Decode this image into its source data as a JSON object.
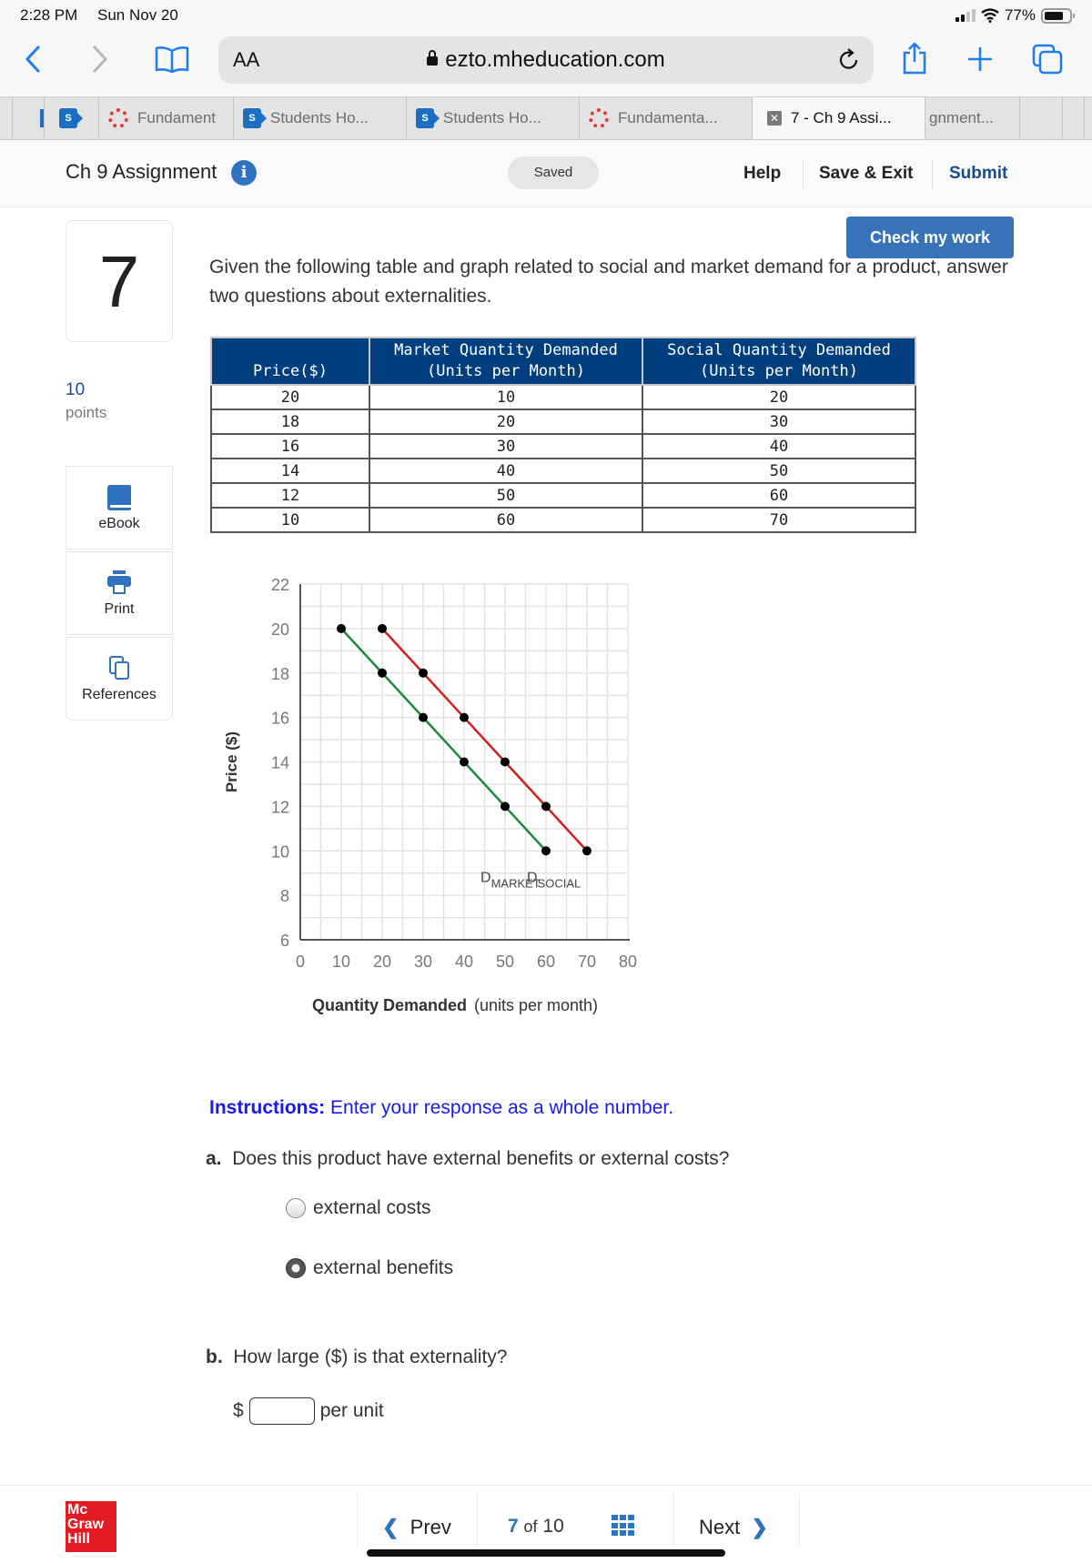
{
  "status_bar": {
    "time": "2:28 PM",
    "date": "Sun Nov 20",
    "battery": "77%",
    "battery_level_percent": 77
  },
  "browser": {
    "text_size_label": "AA",
    "url": "ezto.mheducation.com",
    "icons": [
      "back-icon",
      "forward-icon",
      "bookmarks-icon",
      "lock-icon",
      "reload-icon",
      "share-icon",
      "new-tab-icon",
      "tabs-overview-icon"
    ],
    "tabs": [
      {
        "label": "",
        "icon": "sharepoint-icon"
      },
      {
        "label": "Fundament",
        "icon": "canvas-icon"
      },
      {
        "label": "Students Ho...",
        "icon": "sharepoint-icon"
      },
      {
        "label": "Students Ho...",
        "icon": "sharepoint-icon"
      },
      {
        "label": "Fundamenta...",
        "icon": "canvas-icon"
      },
      {
        "label": "7 - Ch 9 Assi...",
        "icon": "close-tab-icon",
        "active": true
      },
      {
        "label": "gnment...",
        "icon": ""
      }
    ]
  },
  "header": {
    "title": "Ch 9 Assignment",
    "saved_status": "Saved",
    "help": "Help",
    "save_exit": "Save & Exit",
    "submit": "Submit"
  },
  "sidebar": {
    "question_number": "7",
    "points_value": "10",
    "points_label": "points",
    "tools": [
      {
        "label": "eBook",
        "icon": "book-icon"
      },
      {
        "label": "Print",
        "icon": "printer-icon"
      },
      {
        "label": "References",
        "icon": "references-icon"
      }
    ]
  },
  "question": {
    "check_button": "Check my work",
    "prompt": "Given the following table and graph related to social and market demand for a product, answer two questions about externalities.",
    "table": {
      "headers": [
        [
          "",
          "Price($)"
        ],
        [
          "Market Quantity Demanded",
          "(Units per Month)"
        ],
        [
          "Social Quantity Demanded",
          "(Units per Month)"
        ]
      ],
      "rows": [
        [
          "20",
          "10",
          "20"
        ],
        [
          "18",
          "20",
          "30"
        ],
        [
          "16",
          "30",
          "40"
        ],
        [
          "14",
          "40",
          "50"
        ],
        [
          "12",
          "50",
          "60"
        ],
        [
          "10",
          "60",
          "70"
        ]
      ]
    },
    "instructions_label": "Instructions:",
    "instructions_text": "Enter your response as a whole number.",
    "part_a_label": "a.",
    "part_a_text": "Does this product have external benefits or external costs?",
    "part_a_options": [
      {
        "label": "external costs",
        "selected": false
      },
      {
        "label": "external benefits",
        "selected": true
      }
    ],
    "part_b_label": "b.",
    "part_b_text": "How large ($) is that externality?",
    "part_b_prefix": "$",
    "part_b_value": "",
    "part_b_suffix": "per unit"
  },
  "chart_data": {
    "type": "line",
    "title": "",
    "xlabel_bold": "Quantity Demanded",
    "xlabel_rest": "(units per month)",
    "ylabel": "Price ($)",
    "xlim": [
      0,
      80
    ],
    "ylim": [
      6,
      22
    ],
    "x_ticks": [
      0,
      10,
      20,
      30,
      40,
      50,
      60,
      70,
      80
    ],
    "y_ticks": [
      6,
      8,
      10,
      12,
      14,
      16,
      18,
      20,
      22
    ],
    "grid": true,
    "series": [
      {
        "name": "D",
        "subscript": "MARKET",
        "color": "#1e8a3e",
        "points": [
          [
            10,
            20
          ],
          [
            20,
            18
          ],
          [
            30,
            16
          ],
          [
            40,
            14
          ],
          [
            50,
            12
          ],
          [
            60,
            10
          ]
        ]
      },
      {
        "name": "D",
        "subscript": "SOCIAL",
        "color": "#d0201c",
        "points": [
          [
            20,
            20
          ],
          [
            30,
            18
          ],
          [
            40,
            16
          ],
          [
            50,
            14
          ],
          [
            60,
            12
          ],
          [
            70,
            10
          ]
        ]
      }
    ]
  },
  "footer": {
    "logo": [
      "Mc",
      "Graw",
      "Hill"
    ],
    "prev": "Prev",
    "current_page": "7",
    "of_label": "of",
    "total_pages": "10",
    "next": "Next"
  }
}
